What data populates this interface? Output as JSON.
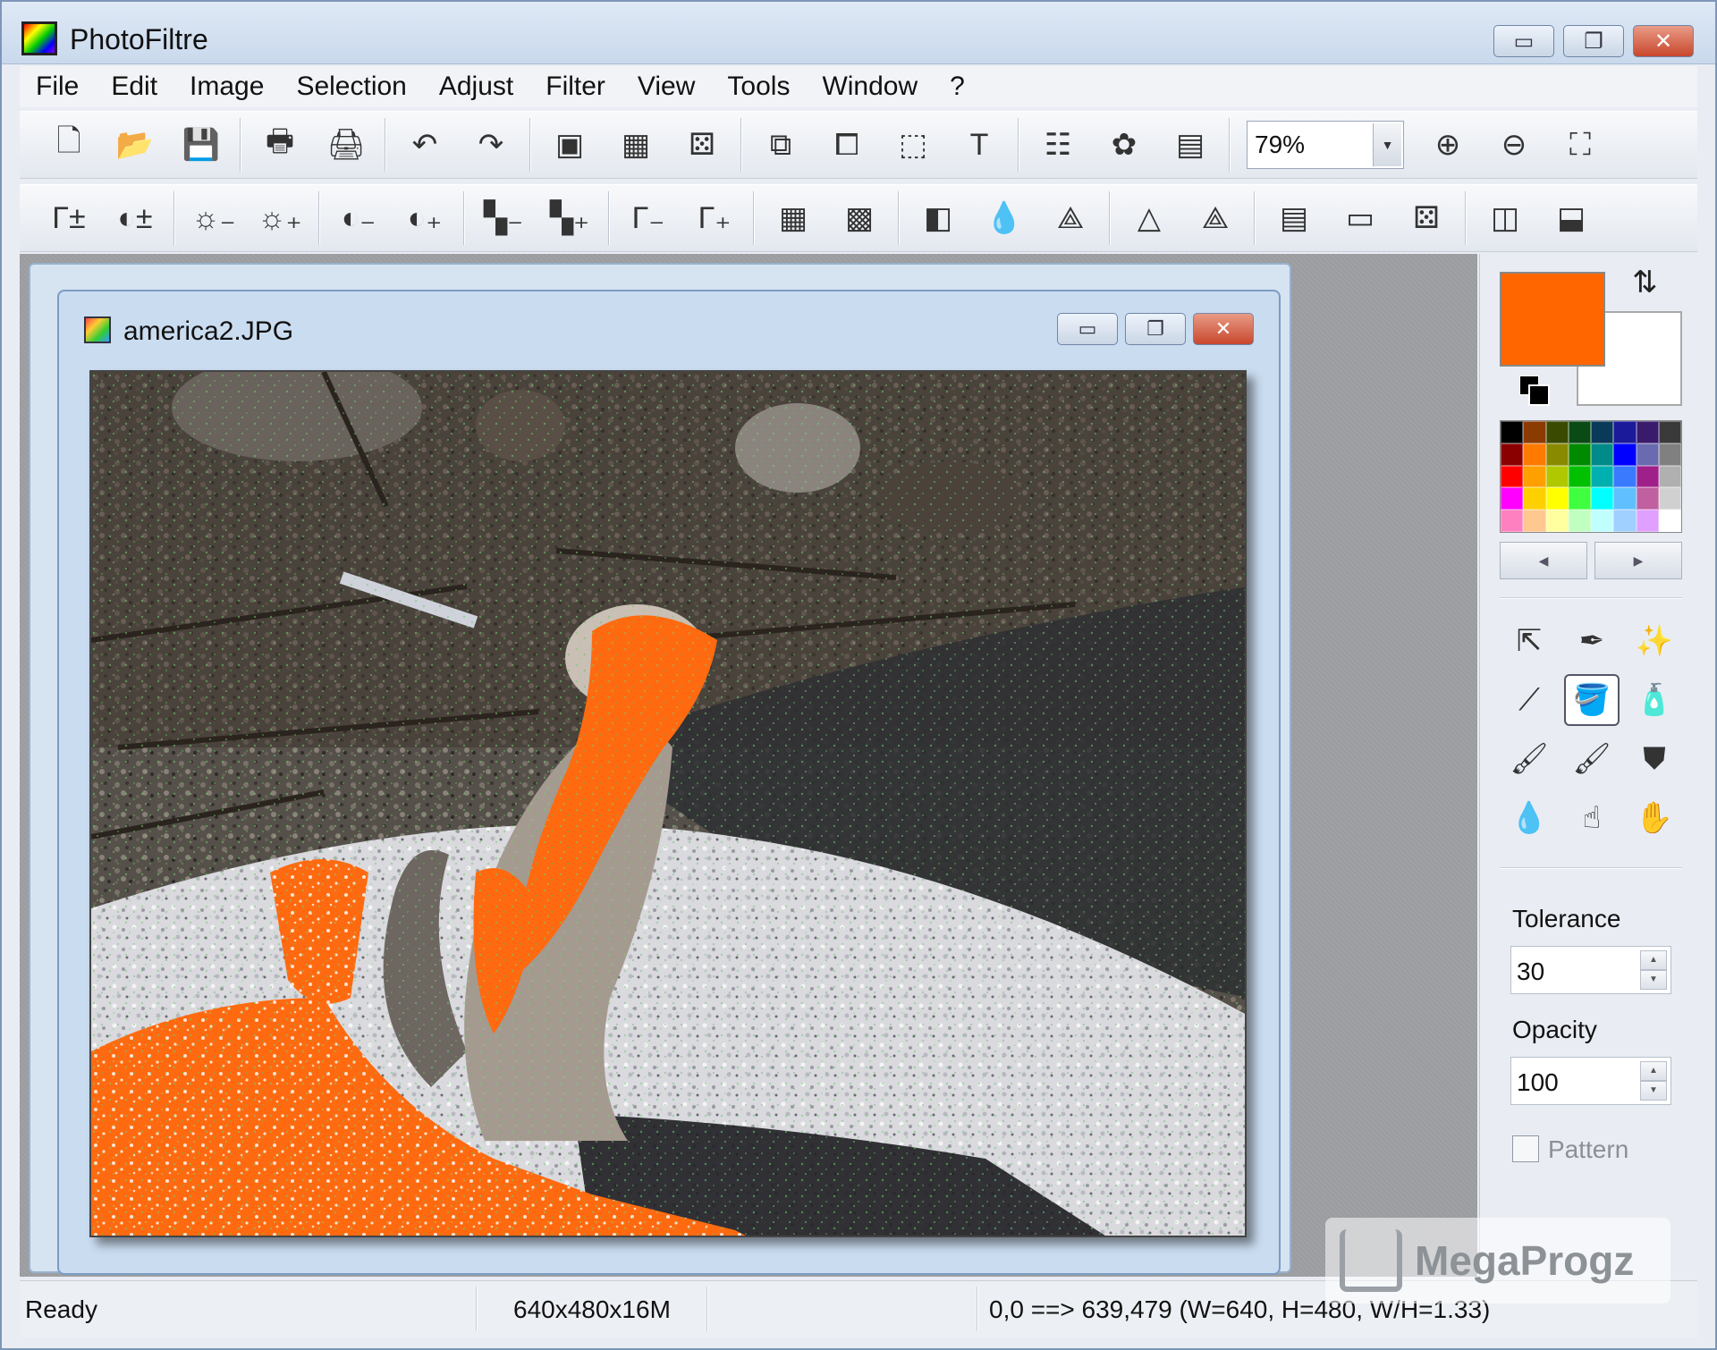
{
  "app": {
    "title": "PhotoFiltre"
  },
  "window_controls": {
    "minimize": "▭",
    "maximize": "❐",
    "close": "✕"
  },
  "menu": [
    "File",
    "Edit",
    "Image",
    "Selection",
    "Adjust",
    "Filter",
    "View",
    "Tools",
    "Window",
    "?"
  ],
  "toolbar1": {
    "groups": [
      [
        {
          "icon": "new-file-icon",
          "glyph": "🗋"
        },
        {
          "icon": "open-folder-icon",
          "glyph": "📂"
        },
        {
          "icon": "save-icon",
          "glyph": "💾"
        }
      ],
      [
        {
          "icon": "print-icon",
          "glyph": "🖶"
        },
        {
          "icon": "scan-icon",
          "glyph": "🖨"
        }
      ],
      [
        {
          "icon": "undo-icon",
          "glyph": "↶"
        },
        {
          "icon": "redo-icon",
          "glyph": "↷"
        }
      ],
      [
        {
          "icon": "grayscale-icon",
          "glyph": "▣"
        },
        {
          "icon": "color-palette-icon",
          "glyph": "▦"
        },
        {
          "icon": "filter-effect-icon",
          "glyph": "⚄"
        }
      ],
      [
        {
          "icon": "duplicate-image-icon",
          "glyph": "⧉"
        },
        {
          "icon": "image-size-icon",
          "glyph": "⧠"
        },
        {
          "icon": "selection-icon",
          "glyph": "⬚"
        },
        {
          "icon": "text-tool-icon",
          "glyph": "T"
        }
      ],
      [
        {
          "icon": "explorer-icon",
          "glyph": "☷"
        },
        {
          "icon": "plugin-icon",
          "glyph": "✿"
        },
        {
          "icon": "window-icon",
          "glyph": "▤"
        }
      ]
    ],
    "zoom_value": "79%",
    "after_zoom": [
      {
        "icon": "zoom-in-icon",
        "glyph": "⊕"
      },
      {
        "icon": "zoom-out-icon",
        "glyph": "⊖"
      },
      {
        "icon": "fit-image-icon",
        "glyph": "⛶"
      }
    ]
  },
  "toolbar2": {
    "groups": [
      [
        {
          "icon": "auto-levels-icon",
          "glyph": "Γ±"
        },
        {
          "icon": "auto-contrast-icon",
          "glyph": "◐±"
        }
      ],
      [
        {
          "icon": "brightness-minus-icon",
          "glyph": "☼₋"
        },
        {
          "icon": "brightness-plus-icon",
          "glyph": "☼₊"
        }
      ],
      [
        {
          "icon": "contrast-minus-icon",
          "glyph": "◐₋"
        },
        {
          "icon": "contrast-plus-icon",
          "glyph": "◐₊"
        }
      ],
      [
        {
          "icon": "saturation-minus-icon",
          "glyph": "▚₋"
        },
        {
          "icon": "saturation-plus-icon",
          "glyph": "▚₊"
        }
      ],
      [
        {
          "icon": "gamma-minus-icon",
          "glyph": "Γ₋"
        },
        {
          "icon": "gamma-plus-icon",
          "glyph": "Γ₊"
        }
      ],
      [
        {
          "icon": "grid-icon",
          "glyph": "▦"
        },
        {
          "icon": "grid-colored-icon",
          "glyph": "▩"
        }
      ],
      [
        {
          "icon": "contrast-half-icon",
          "glyph": "◧"
        },
        {
          "icon": "blur-icon",
          "glyph": "💧"
        },
        {
          "icon": "blur-more-icon",
          "glyph": "⟁"
        }
      ],
      [
        {
          "icon": "sharpen-icon",
          "glyph": "△"
        },
        {
          "icon": "sharpen-more-icon",
          "glyph": "⟁"
        }
      ],
      [
        {
          "icon": "gradient-icon",
          "glyph": "▤"
        },
        {
          "icon": "gradient-bar-icon",
          "glyph": "▭"
        },
        {
          "icon": "texture-icon",
          "glyph": "⚄"
        }
      ],
      [
        {
          "icon": "flip-horizontal-icon",
          "glyph": "◫"
        },
        {
          "icon": "flip-vertical-icon",
          "glyph": "⬓"
        }
      ]
    ]
  },
  "document": {
    "title": "america2.JPG"
  },
  "colors": {
    "foreground": "#ff6600",
    "background": "#ffffff",
    "palette": [
      "#000000",
      "#8b3a00",
      "#3a4a00",
      "#0a4a14",
      "#0a3a5a",
      "#1a1a9a",
      "#3a1a6a",
      "#3a3a3a",
      "#8a0000",
      "#ff7a00",
      "#8a8a00",
      "#008a00",
      "#008a8a",
      "#0000ff",
      "#6a6ab0",
      "#808080",
      "#ff0000",
      "#ffa000",
      "#b0c800",
      "#00c000",
      "#00b0b0",
      "#3a7aff",
      "#a0208a",
      "#b0b0b0",
      "#ff00ff",
      "#ffd000",
      "#ffff00",
      "#40ff40",
      "#00ffff",
      "#60c0ff",
      "#c060a0",
      "#d0d0d0",
      "#ff80c0",
      "#ffc890",
      "#ffffa0",
      "#c0ffc0",
      "#c0ffff",
      "#a0d0ff",
      "#e0a0ff",
      "#ffffff"
    ],
    "swap_icon": "swap-colors-icon",
    "reset_icon": "default-colors-icon"
  },
  "palette_nav": {
    "prev": "◀",
    "next": "▶"
  },
  "tools": [
    {
      "icon": "pointer-icon",
      "glyph": "⇱"
    },
    {
      "icon": "eyedropper-icon",
      "glyph": "✒"
    },
    {
      "icon": "magic-wand-icon",
      "glyph": "✨"
    },
    {
      "icon": "line-icon",
      "glyph": "⟋"
    },
    {
      "icon": "paint-bucket-icon",
      "glyph": "🪣",
      "active": true
    },
    {
      "icon": "spray-icon",
      "glyph": "🧴"
    },
    {
      "icon": "brush-icon",
      "glyph": "🖌"
    },
    {
      "icon": "advanced-brush-icon",
      "glyph": "🖌"
    },
    {
      "icon": "clone-stamp-icon",
      "glyph": "⛊"
    },
    {
      "icon": "blur-drop-icon",
      "glyph": "💧"
    },
    {
      "icon": "smudge-icon",
      "glyph": "☝"
    },
    {
      "icon": "hand-icon",
      "glyph": "✋"
    }
  ],
  "tool_options": {
    "tolerance_label": "Tolerance",
    "tolerance_value": "30",
    "opacity_label": "Opacity",
    "opacity_value": "100",
    "pattern_label": "Pattern"
  },
  "status": {
    "state": "Ready",
    "image_info": "640x480x16M",
    "selection_info": "0,0 ==> 639,479 (W=640, H=480, W/H=1.33)"
  },
  "watermark": {
    "text": "MegaProgz"
  }
}
